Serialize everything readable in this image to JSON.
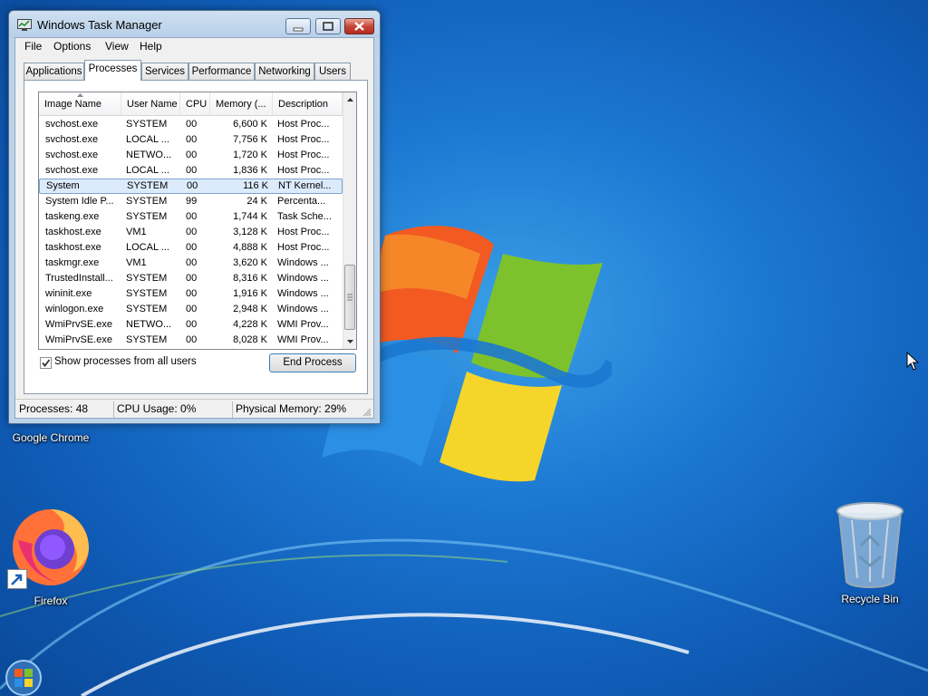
{
  "window": {
    "title": "Windows Task Manager",
    "menu": [
      "File",
      "Options",
      "View",
      "Help"
    ],
    "tabs": [
      "Applications",
      "Processes",
      "Services",
      "Performance",
      "Networking",
      "Users"
    ],
    "active_tab": "Processes"
  },
  "process_table": {
    "columns": [
      "Image Name",
      "User Name",
      "CPU",
      "Memory (...",
      "Description"
    ],
    "sort_column": "Image Name",
    "rows": [
      [
        "svchost.exe",
        "SYSTEM",
        "00",
        "6,600 K",
        "Host Proc..."
      ],
      [
        "svchost.exe",
        "LOCAL ...",
        "00",
        "7,756 K",
        "Host Proc..."
      ],
      [
        "svchost.exe",
        "NETWO...",
        "00",
        "1,720 K",
        "Host Proc..."
      ],
      [
        "svchost.exe",
        "LOCAL ...",
        "00",
        "1,836 K",
        "Host Proc..."
      ],
      [
        "System",
        "SYSTEM",
        "00",
        "116 K",
        "NT Kernel..."
      ],
      [
        "System Idle P...",
        "SYSTEM",
        "99",
        "24 K",
        "Percenta..."
      ],
      [
        "taskeng.exe",
        "SYSTEM",
        "00",
        "1,744 K",
        "Task Sche..."
      ],
      [
        "taskhost.exe",
        "VM1",
        "00",
        "3,128 K",
        "Host Proc..."
      ],
      [
        "taskhost.exe",
        "LOCAL ...",
        "00",
        "4,888 K",
        "Host Proc..."
      ],
      [
        "taskmgr.exe",
        "VM1",
        "00",
        "3,620 K",
        "Windows ..."
      ],
      [
        "TrustedInstall...",
        "SYSTEM",
        "00",
        "8,316 K",
        "Windows ..."
      ],
      [
        "wininit.exe",
        "SYSTEM",
        "00",
        "1,916 K",
        "Windows ..."
      ],
      [
        "winlogon.exe",
        "SYSTEM",
        "00",
        "2,948 K",
        "Windows ..."
      ],
      [
        "WmiPrvSE.exe",
        "NETWO...",
        "00",
        "4,228 K",
        "WMI Prov..."
      ],
      [
        "WmiPrvSE.exe",
        "SYSTEM",
        "00",
        "8,028 K",
        "WMI Prov..."
      ]
    ],
    "selected_row": 4
  },
  "show_all_users": {
    "label": "Show processes from all users",
    "checked": true
  },
  "end_process_label": "End Process",
  "status": {
    "processes": "Processes: 48",
    "cpu": "CPU Usage: 0%",
    "memory": "Physical Memory: 29%"
  },
  "desktop_icons": {
    "chrome": "Google Chrome",
    "firefox": "Firefox",
    "recycle_bin": "Recycle Bin"
  },
  "colors": {
    "desktop_blue": "#1c78d2",
    "selection": "#dcebfc",
    "close_red": "#c7463a"
  }
}
